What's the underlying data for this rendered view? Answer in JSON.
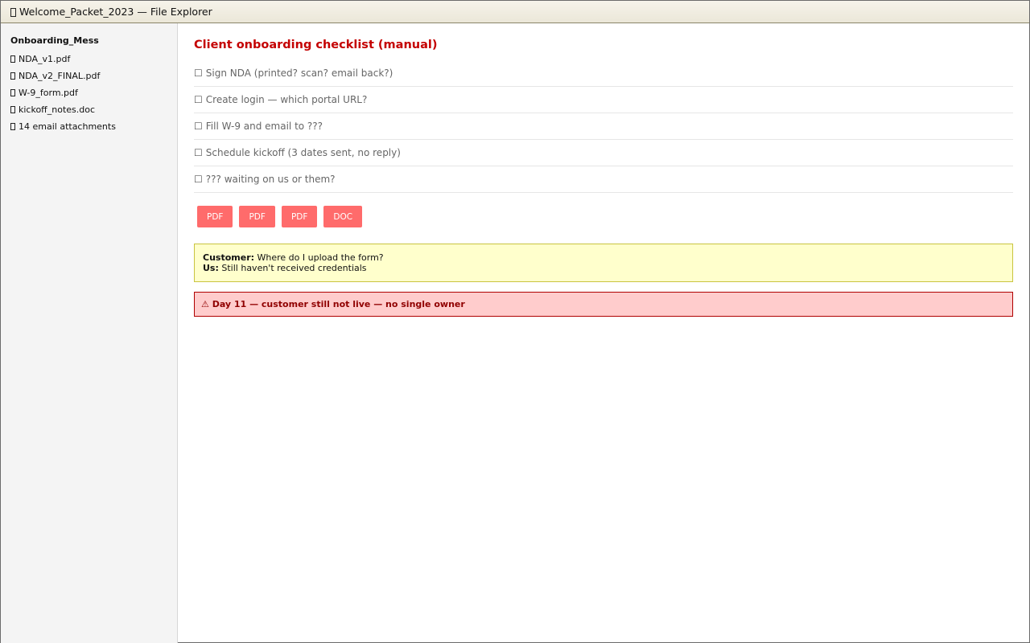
{
  "window": {
    "title": "Welcome_Packet_2023 — File Explorer",
    "title_icon": "folder-icon"
  },
  "sidebar": {
    "root": "Onboarding_Mess",
    "items": [
      {
        "label": "NDA_v1.pdf",
        "icon": "file-icon"
      },
      {
        "label": "NDA_v2_FINAL.pdf",
        "icon": "file-icon"
      },
      {
        "label": "W-9_form.pdf",
        "icon": "file-icon"
      },
      {
        "label": "kickoff_notes.doc",
        "icon": "file-icon"
      },
      {
        "label": "14 email attachments",
        "icon": "file-icon"
      }
    ]
  },
  "main": {
    "title": "Client onboarding checklist (manual)",
    "checkbox_glyph": "☐",
    "checklist": [
      "Sign NDA (printed? scan? email back?)",
      "Create login — which portal URL?",
      "Fill W-9 and email to ???",
      "Schedule kickoff (3 dates sent, no reply)",
      "??? waiting on us or them?"
    ],
    "chips": [
      "PDF",
      "PDF",
      "PDF",
      "DOC"
    ],
    "chat": [
      {
        "speaker": "Customer:",
        "text": " Where do I upload the form?"
      },
      {
        "speaker": "Us:",
        "text": " Still haven't received credentials"
      }
    ],
    "alert": {
      "icon": "⚠",
      "text": "Day 11 — customer still not live — no single owner"
    }
  },
  "colors": {
    "title_red": "#c40000",
    "chip_bg": "#ff6b6b",
    "chat_bg": "#ffffcc",
    "alert_bg": "#ffcccc",
    "alert_text": "#900000"
  }
}
